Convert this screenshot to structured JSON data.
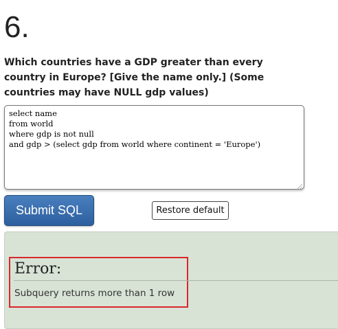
{
  "question": {
    "number": "6.",
    "text": "Which countries have a GDP greater than every country in Europe? [Give the name only.] (Some countries may have NULL gdp values)"
  },
  "editor": {
    "sql": "select name\nfrom world\nwhere gdp is not null\nand gdp > (select gdp from world where continent = 'Europe')"
  },
  "buttons": {
    "submit_label": "Submit SQL",
    "restore_label": "Restore default"
  },
  "result": {
    "error_title": "Error:",
    "error_message": "Subquery returns more than 1 row"
  },
  "colors": {
    "submit_button": "#2c5f9e",
    "result_panel": "#d8e3d6",
    "error_highlight": "#d9262b"
  }
}
